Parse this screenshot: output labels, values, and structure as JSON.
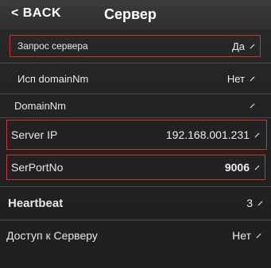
{
  "header": {
    "back_label": "< BACK",
    "title": "Сервер"
  },
  "rows": [
    {
      "label": "Запрос сервера",
      "value": "Да",
      "highlighted": true
    },
    {
      "label": "Исп domainNm",
      "value": "Нет",
      "highlighted": false
    },
    {
      "label": "DomainNm",
      "value": "",
      "highlighted": false
    },
    {
      "label": "Server IP",
      "value": "192.168.001.231",
      "highlighted": true
    },
    {
      "label": "SerPortNo",
      "value": "9006",
      "highlighted": true
    },
    {
      "label": "Heartbeat",
      "value": "3",
      "highlighted": false
    },
    {
      "label": "Доступ к Серверу",
      "value": "Нет",
      "highlighted": false
    }
  ],
  "colors": {
    "highlight_border": "#c8343a",
    "background": "#242424"
  },
  "icons": {
    "back": "chevron-left-icon",
    "edit": "pencil-icon"
  }
}
